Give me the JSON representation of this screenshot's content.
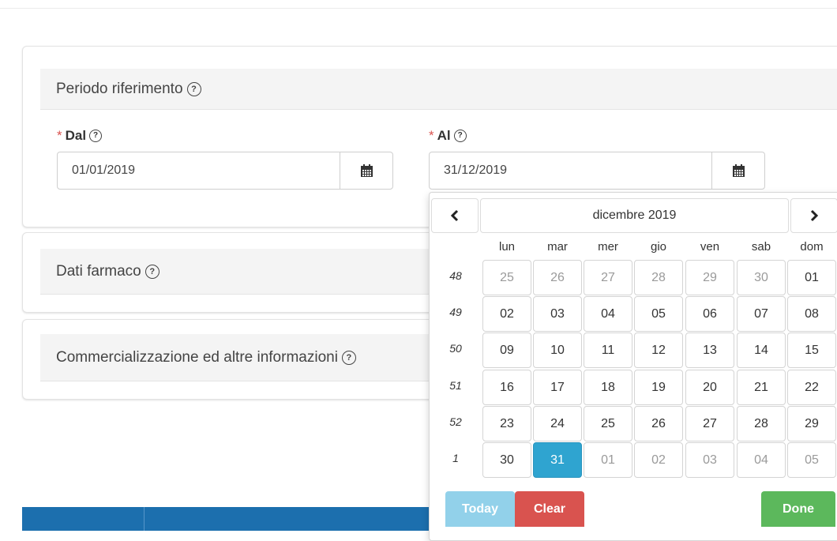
{
  "sections": {
    "periodo": {
      "title": "Periodo riferimento",
      "help": "?"
    },
    "dati": {
      "title": "Dati farmaco",
      "help": "?"
    },
    "commerc": {
      "title": "Commercializzazione ed altre informazioni",
      "help": "?"
    }
  },
  "fields": {
    "dal": {
      "required_mark": "*",
      "label": "Dal",
      "help": "?",
      "value": "01/01/2019"
    },
    "al": {
      "required_mark": "*",
      "label": "Al",
      "help": "?",
      "value": "31/12/2019"
    }
  },
  "datepicker": {
    "prev": "‹",
    "next": "›",
    "month_title": "dicembre 2019",
    "weekdays": [
      "lun",
      "mar",
      "mer",
      "gio",
      "ven",
      "sab",
      "dom"
    ],
    "week_numbers": [
      "48",
      "49",
      "50",
      "51",
      "52",
      "1"
    ],
    "weeks": [
      [
        "25",
        "26",
        "27",
        "28",
        "29",
        "30",
        "01"
      ],
      [
        "02",
        "03",
        "04",
        "05",
        "06",
        "07",
        "08"
      ],
      [
        "09",
        "10",
        "11",
        "12",
        "13",
        "14",
        "15"
      ],
      [
        "16",
        "17",
        "18",
        "19",
        "20",
        "21",
        "22"
      ],
      [
        "23",
        "24",
        "25",
        "26",
        "27",
        "28",
        "29"
      ],
      [
        "30",
        "31",
        "01",
        "02",
        "03",
        "04",
        "05"
      ]
    ],
    "muted": [
      [
        0,
        0
      ],
      [
        0,
        1
      ],
      [
        0,
        2
      ],
      [
        0,
        3
      ],
      [
        0,
        4
      ],
      [
        0,
        5
      ],
      [
        5,
        2
      ],
      [
        5,
        3
      ],
      [
        5,
        4
      ],
      [
        5,
        5
      ],
      [
        5,
        6
      ]
    ],
    "selected": [
      5,
      1
    ],
    "buttons": {
      "today": "Today",
      "clear": "Clear",
      "done": "Done"
    }
  },
  "colors": {
    "accent": "#2fa4d0",
    "today": "#92d1ea",
    "clear": "#d9534f",
    "done": "#5cb85c",
    "bar": "#1c6fae"
  }
}
